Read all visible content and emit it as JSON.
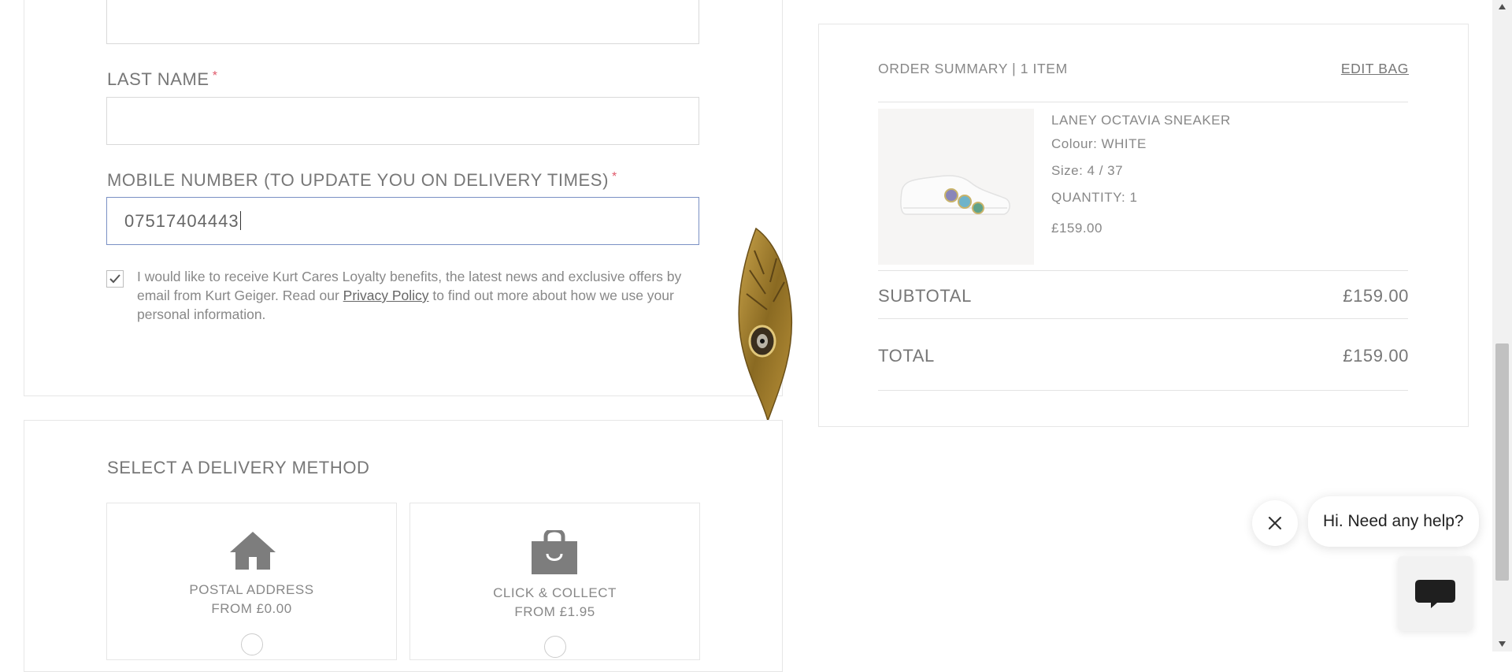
{
  "form": {
    "last_name": {
      "label": "LAST NAME",
      "required_mark": "*",
      "value": ""
    },
    "mobile": {
      "label": "MOBILE NUMBER (TO UPDATE YOU ON DELIVERY TIMES)",
      "required_mark": "*",
      "value": "07517404443"
    },
    "consent": {
      "checked": true,
      "text_before": "I would like to receive Kurt Cares Loyalty benefits, the latest news and exclusive offers by email from Kurt Geiger. Read our ",
      "link": "Privacy Policy",
      "text_after": " to find out more about how we use your personal information."
    }
  },
  "delivery": {
    "title": "SELECT A DELIVERY METHOD",
    "options": [
      {
        "line1": "POSTAL ADDRESS",
        "line2": "FROM £0.00",
        "icon": "house-icon"
      },
      {
        "line1": "CLICK & COLLECT",
        "line2": "FROM £1.95",
        "icon": "shopping-bag-icon"
      }
    ]
  },
  "summary": {
    "heading": "ORDER SUMMARY | 1 ITEM",
    "edit_bag": "EDIT BAG",
    "product": {
      "name": "LANEY OCTAVIA SNEAKER",
      "colour": "Colour: WHITE",
      "size": "Size: 4 / 37",
      "quantity": "QUANTITY: 1",
      "price": "£159.00"
    },
    "subtotal_label": "SUBTOTAL",
    "subtotal_value": "£159.00",
    "total_label": "TOTAL",
    "total_value": "£159.00"
  },
  "chat": {
    "greeting": "Hi. Need any help?",
    "close_icon": "close-icon",
    "launcher_icon": "chat-bubble-icon"
  },
  "colors": {
    "required": "#e05a6b",
    "focus_border": "#7a90c4"
  }
}
